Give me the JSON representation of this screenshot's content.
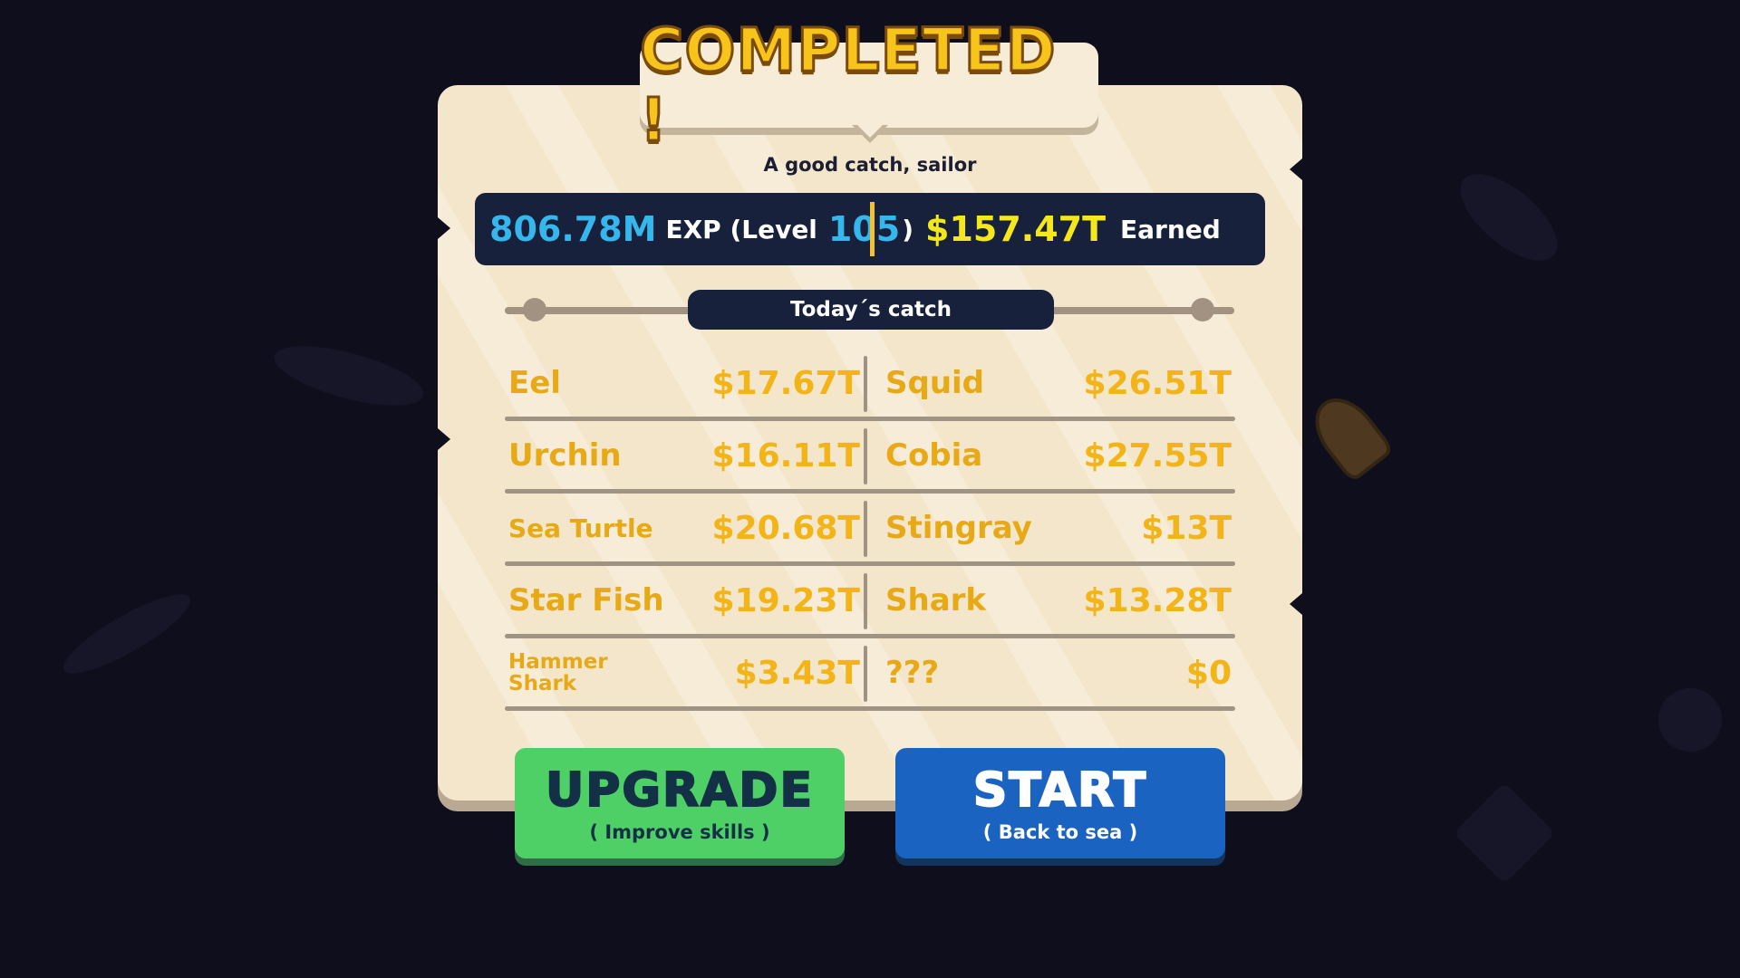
{
  "header": {
    "title": "COMPLETED !",
    "subtitle": "A good catch, sailor"
  },
  "stats": {
    "exp_value": "806.78M",
    "exp_label_prefix": "EXP (Level",
    "level": "105",
    "exp_label_suffix": ")",
    "earned_value": "$157.47T",
    "earned_label": "Earned"
  },
  "catch": {
    "heading": "Today´s catch",
    "rows": [
      {
        "left": {
          "name": "Eel",
          "value": "$17.67T"
        },
        "right": {
          "name": "Squid",
          "value": "$26.51T"
        }
      },
      {
        "left": {
          "name": "Urchin",
          "value": "$16.11T"
        },
        "right": {
          "name": "Cobia",
          "value": "$27.55T"
        }
      },
      {
        "left": {
          "name": "Sea Turtle",
          "value": "$20.68T"
        },
        "right": {
          "name": "Stingray",
          "value": "$13T"
        }
      },
      {
        "left": {
          "name": "Star Fish",
          "value": "$19.23T"
        },
        "right": {
          "name": "Shark",
          "value": "$13.28T"
        }
      },
      {
        "left": {
          "name": "Hammer Shark",
          "value": "$3.43T"
        },
        "right": {
          "name": "???",
          "value": "$0"
        }
      }
    ]
  },
  "buttons": {
    "upgrade": {
      "label": "UPGRADE",
      "sublabel": "( Improve skills )"
    },
    "start": {
      "label": "START",
      "sublabel": "( Back to sea )"
    }
  },
  "colors": {
    "panel": "#f3e6cb",
    "dark_bar": "#17213b",
    "exp_blue": "#35b7ee",
    "earned_yellow": "#f4e81c",
    "catch_gold": "#f2b417",
    "upgrade_green": "#4fd066",
    "start_blue": "#1a63c1"
  }
}
